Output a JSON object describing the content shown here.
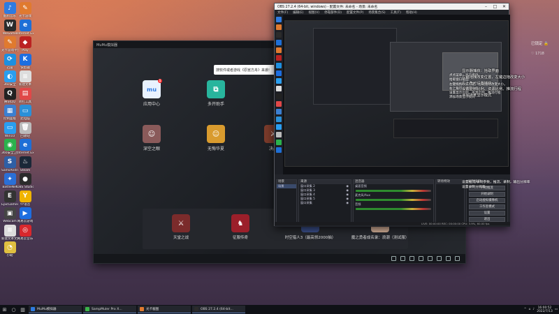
{
  "desktop": {
    "icons": [
      {
        "label": "酷狗音乐",
        "color": "#2f7be0",
        "glyph": "♪"
      },
      {
        "label": "光卡游戏",
        "color": "#e07a2f",
        "glyph": "✎"
      },
      {
        "label": "WeGame",
        "color": "#2b2b2b",
        "glyph": "W"
      },
      {
        "label": "Internet Explorer",
        "color": "#1e6fd6",
        "glyph": "e"
      },
      {
        "label": "光卡游戏平台",
        "color": "#e07a2f",
        "glyph": "✎"
      },
      {
        "label": "Play",
        "color": "#b22",
        "glyph": "◆"
      },
      {
        "label": "迅雷",
        "color": "#1d8fe0",
        "glyph": "⟳"
      },
      {
        "label": "快剪辑",
        "color": "#1d6ee0",
        "glyph": "K"
      },
      {
        "label": "360安全",
        "color": "#2a9ef0",
        "glyph": "◐"
      },
      {
        "label": "新建文本",
        "color": "#dddddd",
        "glyph": "≡"
      },
      {
        "label": "腾讯QQ",
        "color": "#222",
        "glyph": "Q"
      },
      {
        "label": "听打工具",
        "color": "#e04848",
        "glyph": "▤"
      },
      {
        "label": "控制面板",
        "color": "#3b7fd1",
        "glyph": "▦"
      },
      {
        "label": "此电脑",
        "color": "#2a90d8",
        "glyph": "▭"
      },
      {
        "label": "Win10",
        "color": "#2a9ef0",
        "glyph": "▭"
      },
      {
        "label": "回收站",
        "color": "#bbbbbb",
        "glyph": "🗑"
      },
      {
        "label": "360安全卫士",
        "color": "#2bb24c",
        "glyph": "◉"
      },
      {
        "label": "Internet Explorer",
        "color": "#1e6fd6",
        "glyph": "e"
      },
      {
        "label": "SamsAndroid",
        "color": "#2f5fa5",
        "glyph": "S"
      },
      {
        "label": "Steam",
        "color": "#1b2838",
        "glyph": "♨"
      },
      {
        "label": "BattleNet",
        "color": "#2b6fd6",
        "glyph": "✦"
      },
      {
        "label": "OBS Studio",
        "color": "#2b2b2b",
        "glyph": "●"
      },
      {
        "label": "EpicGames",
        "color": "#333",
        "glyph": "E"
      },
      {
        "label": "YY语音",
        "color": "#f0b400",
        "glyph": "Y"
      },
      {
        "label": "Webcam",
        "color": "#444",
        "glyph": "▣"
      },
      {
        "label": "网易云游戏",
        "color": "#1d6ee0",
        "glyph": "▶"
      },
      {
        "label": "新建文本文档",
        "color": "#dddddd",
        "glyph": "≡"
      },
      {
        "label": "网易云音乐",
        "color": "#d8282d",
        "glyph": "◎"
      },
      {
        "label": "小助",
        "color": "#e0c040",
        "glyph": "◔"
      }
    ]
  },
  "emulator": {
    "title": "MuMu模拟器",
    "search_placeholder": "搜软件或者游戏《原宫方舟》来袭!",
    "apps": [
      {
        "label": "应用中心",
        "color": "#e9f2ff",
        "glyph": "mu",
        "badge": "1"
      },
      {
        "label": "多开助手",
        "color": "#28b59d",
        "glyph": "⧉",
        "badge": ""
      },
      {
        "label": "深空之眼",
        "color": "#8a5a5a",
        "glyph": "☺",
        "badge": ""
      },
      {
        "label": "无悔华夏",
        "color": "#d99b2e",
        "glyph": "☺",
        "badge": ""
      },
      {
        "label": "决战",
        "color": "#7b3b2b",
        "glyph": "⚔",
        "badge": ""
      }
    ],
    "dock": [
      {
        "label": "天堂之战",
        "color": "#7b2b2b",
        "glyph": "⚔"
      },
      {
        "label": "征服传奇",
        "color": "#9b1f2a",
        "glyph": "♞"
      },
      {
        "label": "时空猎人3（最高领2000抽）",
        "color": "#3a4f8b",
        "glyph": "✦"
      },
      {
        "label": "魔之勇者成名录：浪潮（测试服）",
        "color": "#d9b39b",
        "glyph": "☺"
      }
    ]
  },
  "obs": {
    "title": "OBS 27.2.4 (64-bit, windows) - 配置文件: 未命名 - 场景: 未命名",
    "menu": [
      "文件(F)",
      "编辑(E)",
      "视图(V)",
      "停靠部件(D)",
      "配置文件(P)",
      "场景集合(S)",
      "工具(T)",
      "帮助(H)"
    ],
    "overlay_lines": [
      "点点菜单：显示模块",
      "拾取窗口截图",
      "左键拖拽改变位置，左键边拖改变大小。",
      "右上角可以设置采集",
      "设置显示比例、资源比例、推流行程",
      "添加场景显示模式"
    ],
    "panels": {
      "scenes_title": "场景",
      "sources_title": "来源",
      "mixer_title": "混音器",
      "transitions_title": "转场特效",
      "controls_title": "控制按钮"
    },
    "sources": [
      "窗口采集 2",
      "窗口采集 3",
      "窗口采集 4",
      "窗口采集 5",
      "窗口采集"
    ],
    "scene": "场景",
    "mixer_tracks": [
      "桌面音频",
      "麦克风/Aux",
      "音频"
    ],
    "controls": [
      "开始推流",
      "开始录制",
      "启动虚拟摄像机",
      "工作室模式",
      "设置",
      "退出"
    ],
    "status": "LIVE: 00:00:00  REC: 00:00:00  CPU: 3.9%, 60.00 fps"
  },
  "overlays": {
    "locked": "已锁定",
    "follow_count": "1718",
    "annotation": [
      "显示器捕获：拾取界面",
      "左键拖拽改变位置，左键边拖改变大小",
      "右上角可设置捕获",
      "设置显示比例、资源比例、推流行程",
      "添加场景显示模式"
    ],
    "annotation2": [
      "设置推流/录制参数，推流、录制，输出分辨率",
      "设置录制分辨率"
    ]
  },
  "taskbar": {
    "apps": [
      {
        "label": "MuMu模拟器",
        "color": "#2f7be0"
      },
      {
        "label": "SampMuler Pro X...",
        "color": "#3bb34a"
      },
      {
        "label": "光卡截图",
        "color": "#e07a2f"
      },
      {
        "label": "OBS 27.2.4 (64-bit...",
        "color": "#2b2b2b"
      }
    ],
    "time": "16:00:52",
    "date": "2022/7/13"
  }
}
